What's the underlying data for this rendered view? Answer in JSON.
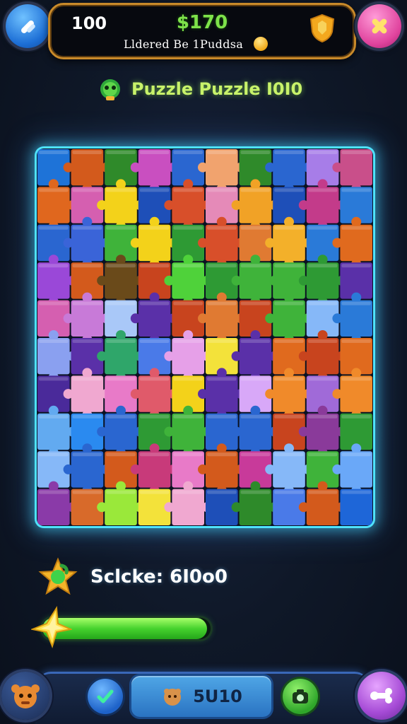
{
  "hud": {
    "level": "100",
    "money": "$170",
    "subtitle": "Lldered Be 1Puddsa"
  },
  "title": {
    "text": "Puzzle Puzzle I0I0"
  },
  "board": {
    "columns": 10,
    "rows": 10,
    "colors": [
      [
        "#1e73d8",
        "#d35a1c",
        "#2f8a2a",
        "#c94fc0",
        "#2a66d0",
        "#f1a36e",
        "#2f8a2a",
        "#2a66d0",
        "#a77de8",
        "#c94f8a"
      ],
      [
        "#e0671e",
        "#d55fb0",
        "#f3d21a",
        "#1e4fb8",
        "#d84f2a",
        "#e58ab8",
        "#f1a226",
        "#1e4fb8",
        "#c33b8a",
        "#2a7ad8"
      ],
      [
        "#2a66d0",
        "#3a64d8",
        "#3fb33a",
        "#f3d21a",
        "#2e9a34",
        "#d84f2a",
        "#e07a32",
        "#f3b02a",
        "#2a7ad8",
        "#e06a1e"
      ],
      [
        "#9a48d8",
        "#d35a1c",
        "#6a4a1a",
        "#c8441e",
        "#4fd23a",
        "#2e9a34",
        "#3fb33a",
        "#3fb33a",
        "#2e9a34",
        "#5a30a8"
      ],
      [
        "#d55fb0",
        "#c87ad8",
        "#a9c8f8",
        "#5a30a8",
        "#c8441e",
        "#e07a32",
        "#c8441e",
        "#3fb33a",
        "#86b8f8",
        "#2a7ad8"
      ],
      [
        "#8aa0f0",
        "#5a30a8",
        "#2fa66a",
        "#4a7ae8",
        "#e6a0e8",
        "#f3e23a",
        "#5a30a8",
        "#e06a1e",
        "#c8441e",
        "#e06a1e"
      ],
      [
        "#4a2a9a",
        "#f0a8d0",
        "#e87ac8",
        "#e05a6a",
        "#f3d21a",
        "#5a30a8",
        "#d8a8f8",
        "#f08a2a",
        "#a06ad8",
        "#f08a2a"
      ],
      [
        "#62aaf0",
        "#2a8af0",
        "#2a66d0",
        "#2e9a34",
        "#3fb33a",
        "#2a66d0",
        "#2a66d0",
        "#c8441e",
        "#8a3a9a",
        "#2e9a34"
      ],
      [
        "#86b8f8",
        "#2a66d0",
        "#d35a1c",
        "#c83a7a",
        "#e87ac8",
        "#d35a1c",
        "#c83a9a",
        "#86b8f8",
        "#3fb33a",
        "#6aa8f8"
      ],
      [
        "#8a3aa8",
        "#d86a2a",
        "#9ae83a",
        "#f3e23a",
        "#f0a8d0",
        "#1e4fb8",
        "#2e8a2a",
        "#4a7ae8",
        "#d35a1c",
        "#1e66d8"
      ]
    ]
  },
  "score": {
    "label": "Sclcke: 6I0o0"
  },
  "progress": {
    "fraction": 0.98
  },
  "bottom_bar": {
    "center_label": "5U10"
  }
}
